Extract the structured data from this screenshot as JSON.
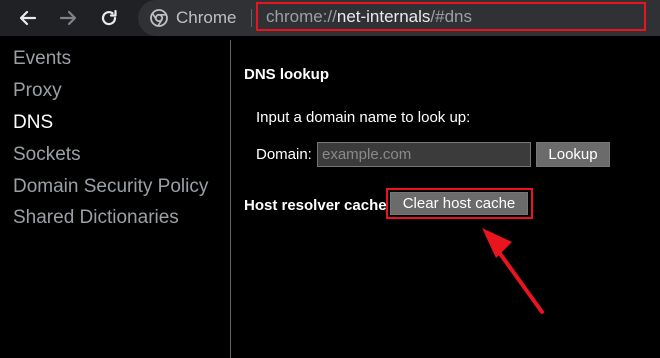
{
  "browser": {
    "chip_label": "Chrome",
    "url_scheme": "chrome://",
    "url_host": "net-internals",
    "url_path": "/#dns"
  },
  "sidebar": {
    "items": [
      {
        "label": "Events",
        "active": false
      },
      {
        "label": "Proxy",
        "active": false
      },
      {
        "label": "DNS",
        "active": true
      },
      {
        "label": "Sockets",
        "active": false
      },
      {
        "label": "Domain Security Policy",
        "active": false
      },
      {
        "label": "Shared Dictionaries",
        "active": false
      }
    ]
  },
  "dns": {
    "heading": "DNS lookup",
    "hint": "Input a domain name to look up:",
    "domain_label": "Domain:",
    "domain_placeholder": "example.com",
    "domain_value": "",
    "lookup_label": "Lookup",
    "host_cache_heading": "Host resolver cache",
    "clear_label": "Clear host cache"
  },
  "colors": {
    "highlight": "#e8151f",
    "toolbar_bg": "#202124",
    "page_bg": "#000000"
  }
}
